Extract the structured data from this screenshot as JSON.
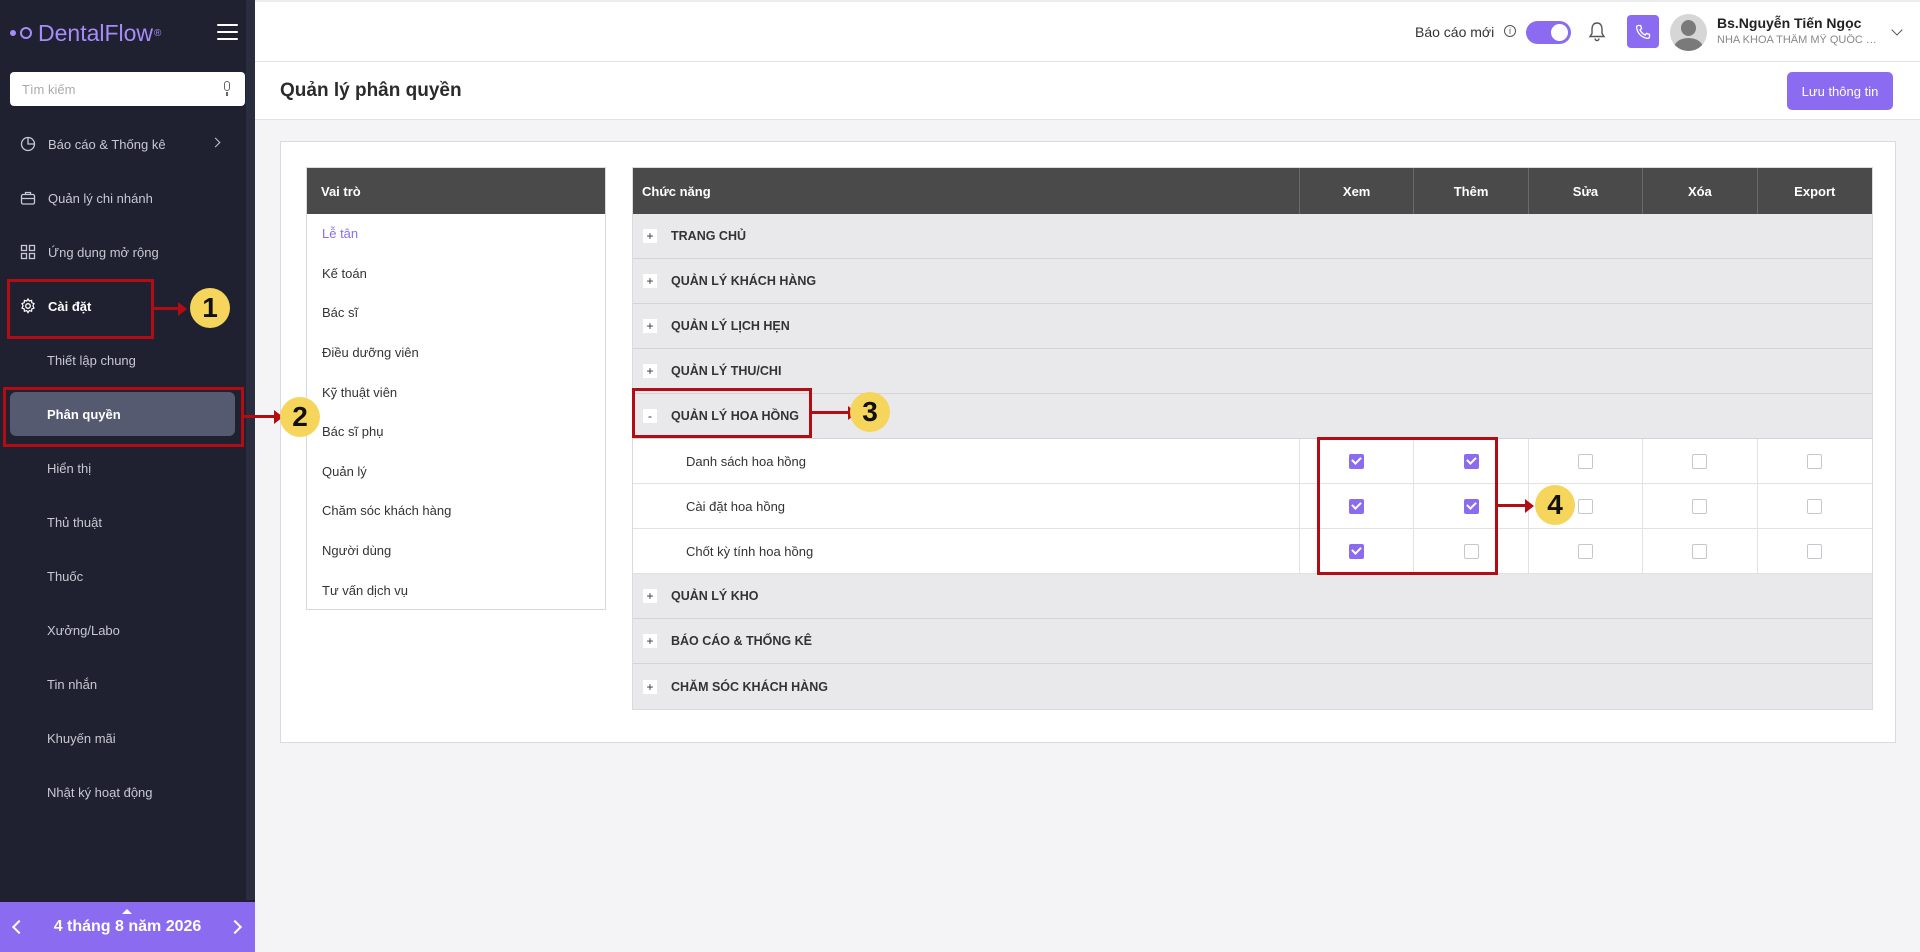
{
  "brand": {
    "name": "DentalFlow",
    "mark": "®"
  },
  "search": {
    "placeholder": "Tìm kiếm"
  },
  "sidebar": {
    "items": [
      {
        "label": "Báo cáo & Thống kê"
      },
      {
        "label": "Quản lý chi nhánh"
      },
      {
        "label": "Ứng dụng mở rộng"
      },
      {
        "label": "Cài đặt"
      }
    ],
    "subitems": [
      {
        "label": "Thiết lập chung"
      },
      {
        "label": "Phân quyền"
      },
      {
        "label": "Hiển thị"
      },
      {
        "label": "Thủ thuật"
      },
      {
        "label": "Thuốc"
      },
      {
        "label": "Xưởng/Labo"
      },
      {
        "label": "Tin nhắn"
      },
      {
        "label": "Khuyến mãi"
      },
      {
        "label": "Nhật ký hoạt động"
      }
    ],
    "date": "4 tháng 8 năm 2026"
  },
  "header": {
    "new_report": "Báo cáo mới",
    "user_name": "Bs.Nguyễn Tiến Ngọc",
    "user_clinic": "NHA KHOA THẨM MỸ QUỐC TẾ"
  },
  "page": {
    "title": "Quản lý phân quyền",
    "save": "Lưu thông tin"
  },
  "roles": {
    "header": "Vai trò",
    "items": [
      "Lễ tân",
      "Kế toán",
      "Bác sĩ",
      "Điều dưỡng viên",
      "Kỹ thuật viên",
      "Bác sĩ phụ",
      "Quản lý",
      "Chăm sóc khách hàng",
      "Người dùng",
      "Tư vấn dịch vụ"
    ]
  },
  "permissions": {
    "headers": [
      "Chức năng",
      "Xem",
      "Thêm",
      "Sửa",
      "Xóa",
      "Export"
    ],
    "groups": [
      {
        "label": "TRANG CHỦ",
        "toggle": "+"
      },
      {
        "label": "QUẢN LÝ KHÁCH HÀNG",
        "toggle": "+"
      },
      {
        "label": "QUẢN LÝ LỊCH HẸN",
        "toggle": "+"
      },
      {
        "label": "QUẢN LÝ THU/CHI",
        "toggle": "+"
      },
      {
        "label": "QUẢN LÝ HOA HỒNG",
        "toggle": "-"
      },
      {
        "label": "QUẢN LÝ KHO",
        "toggle": "+"
      },
      {
        "label": "BÁO CÁO & THỐNG KÊ",
        "toggle": "+"
      },
      {
        "label": "CHĂM SÓC KHÁCH HÀNG",
        "toggle": "+"
      }
    ],
    "rows": [
      {
        "label": "Danh sách hoa hồng",
        "checks": [
          true,
          true,
          false,
          false,
          false
        ]
      },
      {
        "label": "Cài đặt hoa hồng",
        "checks": [
          true,
          true,
          false,
          false,
          false
        ]
      },
      {
        "label": "Chốt kỳ tính hoa hồng",
        "checks": [
          true,
          false,
          false,
          false,
          false
        ]
      }
    ]
  },
  "annotations": [
    "1",
    "2",
    "3",
    "4"
  ],
  "colors": {
    "accent": "#8b6cf0",
    "sidebar": "#1f2130",
    "annotation": "#b20c14",
    "badge": "#f6d55c"
  }
}
